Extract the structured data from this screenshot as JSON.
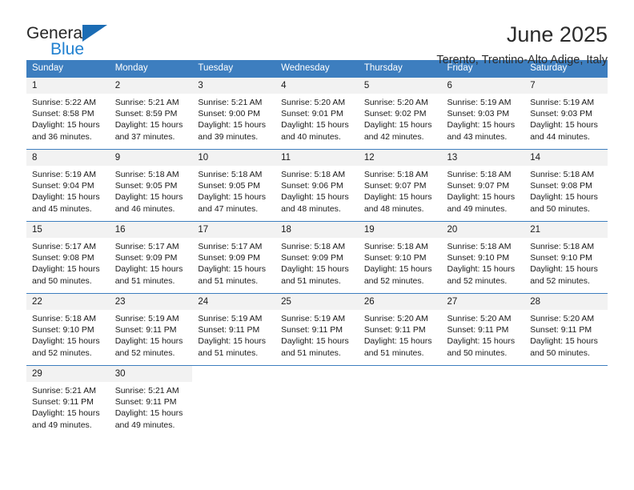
{
  "brand": {
    "name_top": "General",
    "name_bottom": "Blue",
    "triangle_color": "#1b6cb4",
    "bottom_color": "#2080d0"
  },
  "header": {
    "title": "June 2025",
    "subtitle": "Terento, Trentino-Alto Adige, Italy"
  },
  "theme": {
    "header_bg": "#3d7ebf",
    "header_text": "#ffffff",
    "daynum_bg": "#f2f2f2",
    "cell_border": "#3d7ebf"
  },
  "calendar": {
    "weekday_headers": [
      "Sunday",
      "Monday",
      "Tuesday",
      "Wednesday",
      "Thursday",
      "Friday",
      "Saturday"
    ],
    "weeks": [
      [
        {
          "day": "1",
          "sunrise": "Sunrise: 5:22 AM",
          "sunset": "Sunset: 8:58 PM",
          "daylight": "Daylight: 15 hours and 36 minutes."
        },
        {
          "day": "2",
          "sunrise": "Sunrise: 5:21 AM",
          "sunset": "Sunset: 8:59 PM",
          "daylight": "Daylight: 15 hours and 37 minutes."
        },
        {
          "day": "3",
          "sunrise": "Sunrise: 5:21 AM",
          "sunset": "Sunset: 9:00 PM",
          "daylight": "Daylight: 15 hours and 39 minutes."
        },
        {
          "day": "4",
          "sunrise": "Sunrise: 5:20 AM",
          "sunset": "Sunset: 9:01 PM",
          "daylight": "Daylight: 15 hours and 40 minutes."
        },
        {
          "day": "5",
          "sunrise": "Sunrise: 5:20 AM",
          "sunset": "Sunset: 9:02 PM",
          "daylight": "Daylight: 15 hours and 42 minutes."
        },
        {
          "day": "6",
          "sunrise": "Sunrise: 5:19 AM",
          "sunset": "Sunset: 9:03 PM",
          "daylight": "Daylight: 15 hours and 43 minutes."
        },
        {
          "day": "7",
          "sunrise": "Sunrise: 5:19 AM",
          "sunset": "Sunset: 9:03 PM",
          "daylight": "Daylight: 15 hours and 44 minutes."
        }
      ],
      [
        {
          "day": "8",
          "sunrise": "Sunrise: 5:19 AM",
          "sunset": "Sunset: 9:04 PM",
          "daylight": "Daylight: 15 hours and 45 minutes."
        },
        {
          "day": "9",
          "sunrise": "Sunrise: 5:18 AM",
          "sunset": "Sunset: 9:05 PM",
          "daylight": "Daylight: 15 hours and 46 minutes."
        },
        {
          "day": "10",
          "sunrise": "Sunrise: 5:18 AM",
          "sunset": "Sunset: 9:05 PM",
          "daylight": "Daylight: 15 hours and 47 minutes."
        },
        {
          "day": "11",
          "sunrise": "Sunrise: 5:18 AM",
          "sunset": "Sunset: 9:06 PM",
          "daylight": "Daylight: 15 hours and 48 minutes."
        },
        {
          "day": "12",
          "sunrise": "Sunrise: 5:18 AM",
          "sunset": "Sunset: 9:07 PM",
          "daylight": "Daylight: 15 hours and 48 minutes."
        },
        {
          "day": "13",
          "sunrise": "Sunrise: 5:18 AM",
          "sunset": "Sunset: 9:07 PM",
          "daylight": "Daylight: 15 hours and 49 minutes."
        },
        {
          "day": "14",
          "sunrise": "Sunrise: 5:18 AM",
          "sunset": "Sunset: 9:08 PM",
          "daylight": "Daylight: 15 hours and 50 minutes."
        }
      ],
      [
        {
          "day": "15",
          "sunrise": "Sunrise: 5:17 AM",
          "sunset": "Sunset: 9:08 PM",
          "daylight": "Daylight: 15 hours and 50 minutes."
        },
        {
          "day": "16",
          "sunrise": "Sunrise: 5:17 AM",
          "sunset": "Sunset: 9:09 PM",
          "daylight": "Daylight: 15 hours and 51 minutes."
        },
        {
          "day": "17",
          "sunrise": "Sunrise: 5:17 AM",
          "sunset": "Sunset: 9:09 PM",
          "daylight": "Daylight: 15 hours and 51 minutes."
        },
        {
          "day": "18",
          "sunrise": "Sunrise: 5:18 AM",
          "sunset": "Sunset: 9:09 PM",
          "daylight": "Daylight: 15 hours and 51 minutes."
        },
        {
          "day": "19",
          "sunrise": "Sunrise: 5:18 AM",
          "sunset": "Sunset: 9:10 PM",
          "daylight": "Daylight: 15 hours and 52 minutes."
        },
        {
          "day": "20",
          "sunrise": "Sunrise: 5:18 AM",
          "sunset": "Sunset: 9:10 PM",
          "daylight": "Daylight: 15 hours and 52 minutes."
        },
        {
          "day": "21",
          "sunrise": "Sunrise: 5:18 AM",
          "sunset": "Sunset: 9:10 PM",
          "daylight": "Daylight: 15 hours and 52 minutes."
        }
      ],
      [
        {
          "day": "22",
          "sunrise": "Sunrise: 5:18 AM",
          "sunset": "Sunset: 9:10 PM",
          "daylight": "Daylight: 15 hours and 52 minutes."
        },
        {
          "day": "23",
          "sunrise": "Sunrise: 5:19 AM",
          "sunset": "Sunset: 9:11 PM",
          "daylight": "Daylight: 15 hours and 52 minutes."
        },
        {
          "day": "24",
          "sunrise": "Sunrise: 5:19 AM",
          "sunset": "Sunset: 9:11 PM",
          "daylight": "Daylight: 15 hours and 51 minutes."
        },
        {
          "day": "25",
          "sunrise": "Sunrise: 5:19 AM",
          "sunset": "Sunset: 9:11 PM",
          "daylight": "Daylight: 15 hours and 51 minutes."
        },
        {
          "day": "26",
          "sunrise": "Sunrise: 5:20 AM",
          "sunset": "Sunset: 9:11 PM",
          "daylight": "Daylight: 15 hours and 51 minutes."
        },
        {
          "day": "27",
          "sunrise": "Sunrise: 5:20 AM",
          "sunset": "Sunset: 9:11 PM",
          "daylight": "Daylight: 15 hours and 50 minutes."
        },
        {
          "day": "28",
          "sunrise": "Sunrise: 5:20 AM",
          "sunset": "Sunset: 9:11 PM",
          "daylight": "Daylight: 15 hours and 50 minutes."
        }
      ],
      [
        {
          "day": "29",
          "sunrise": "Sunrise: 5:21 AM",
          "sunset": "Sunset: 9:11 PM",
          "daylight": "Daylight: 15 hours and 49 minutes."
        },
        {
          "day": "30",
          "sunrise": "Sunrise: 5:21 AM",
          "sunset": "Sunset: 9:11 PM",
          "daylight": "Daylight: 15 hours and 49 minutes."
        },
        null,
        null,
        null,
        null,
        null
      ]
    ]
  }
}
